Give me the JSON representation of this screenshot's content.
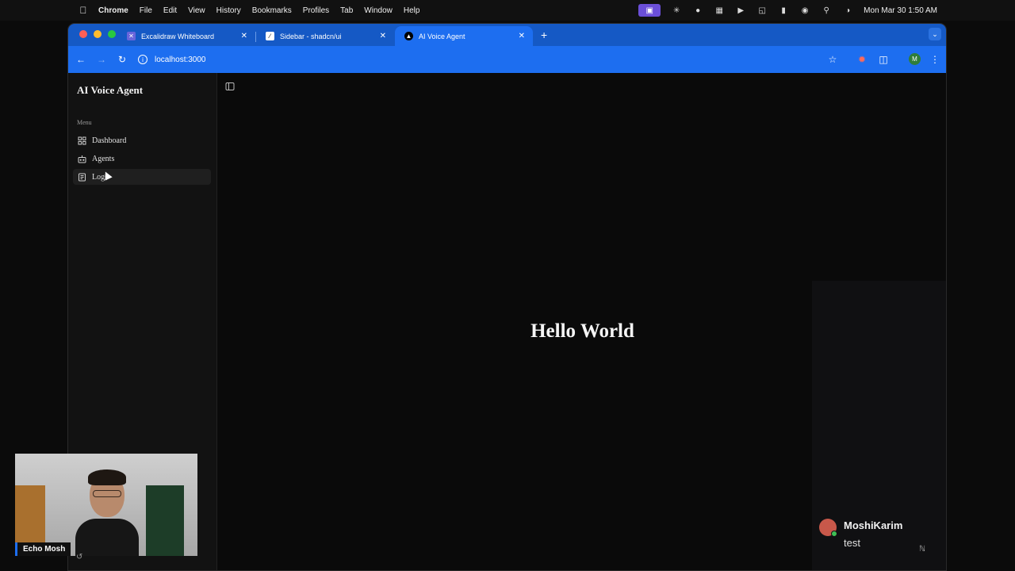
{
  "menubar": {
    "app_name": "Chrome",
    "items": [
      "File",
      "Edit",
      "View",
      "History",
      "Bookmarks",
      "Profiles",
      "Tab",
      "Window",
      "Help"
    ],
    "clock": "Mon Mar 30  1:50 AM"
  },
  "browser": {
    "tabs": [
      {
        "label": "Excalidraw Whiteboard",
        "icon": "excalidraw-icon"
      },
      {
        "label": "Sidebar - shadcn/ui",
        "icon": "shadcn-icon"
      },
      {
        "label": "AI Voice Agent",
        "icon": "vercel-triangle-icon"
      }
    ],
    "url": "localhost:3000",
    "profile_initial": "M",
    "colors": {
      "frame": "#1559c5",
      "toolbar": "#1d6ef0"
    }
  },
  "sidebar": {
    "brand": "AI Voice Agent",
    "menu_label": "Menu",
    "items": [
      {
        "label": "Dashboard",
        "icon": "dashboard-icon"
      },
      {
        "label": "Agents",
        "icon": "agents-icon"
      },
      {
        "label": "Logs",
        "icon": "logs-icon"
      }
    ]
  },
  "main": {
    "heading": "Hello World"
  },
  "webcam": {
    "name": "Echo Mosh"
  },
  "notification": {
    "name": "MoshiKarim",
    "message": "test"
  }
}
